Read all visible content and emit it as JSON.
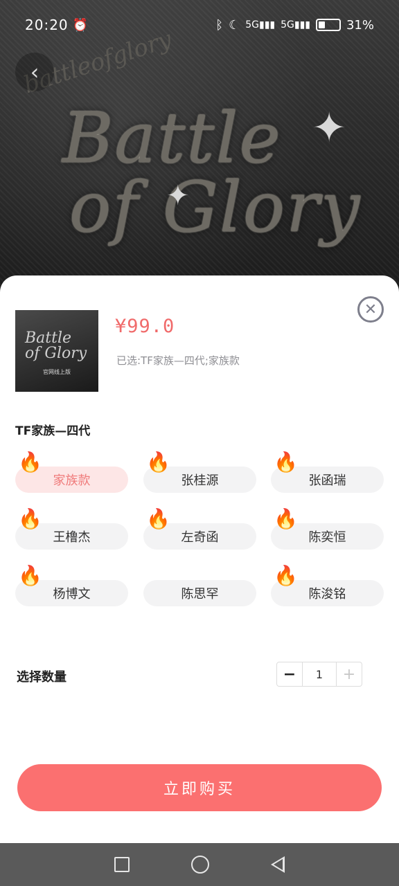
{
  "status": {
    "time": "20:20",
    "battery": "31%",
    "battery_level": 0.31
  },
  "banner": {
    "title_line1": "Battle",
    "title_line2": "of Glory",
    "subtitle": "battleofglory"
  },
  "product": {
    "price": "¥99.0",
    "selected": "已选:TF家族—四代;家族款",
    "thumb_title_line1": "Battle",
    "thumb_title_line2": "of Glory",
    "thumb_sub": "官网线上版"
  },
  "group": {
    "title": "TF家族—四代",
    "options": [
      {
        "label": "家族款",
        "flame": true,
        "active": true
      },
      {
        "label": "张桂源",
        "flame": true,
        "active": false
      },
      {
        "label": "张函瑞",
        "flame": true,
        "active": false
      },
      {
        "label": "王橹杰",
        "flame": true,
        "active": false
      },
      {
        "label": "左奇函",
        "flame": true,
        "active": false
      },
      {
        "label": "陈奕恒",
        "flame": true,
        "active": false
      },
      {
        "label": "杨博文",
        "flame": true,
        "active": false
      },
      {
        "label": "陈思罕",
        "flame": false,
        "active": false
      },
      {
        "label": "陈浚铭",
        "flame": true,
        "active": false
      }
    ]
  },
  "quantity": {
    "label": "选择数量",
    "value": "1",
    "minus": "−",
    "plus": "+"
  },
  "actions": {
    "buy_label": "立即购买"
  },
  "icons": {
    "back": "back-chevron-icon",
    "close": "close-icon",
    "flame": "flame-icon",
    "alarm": "alarm-icon",
    "bluetooth": "bluetooth-icon",
    "moon": "moon-icon",
    "signal": "signal-icon"
  },
  "colors": {
    "accent": "#fb7070",
    "price": "#f06a6a",
    "active_bg": "#fde6e6",
    "chip_bg": "#f3f3f4"
  }
}
